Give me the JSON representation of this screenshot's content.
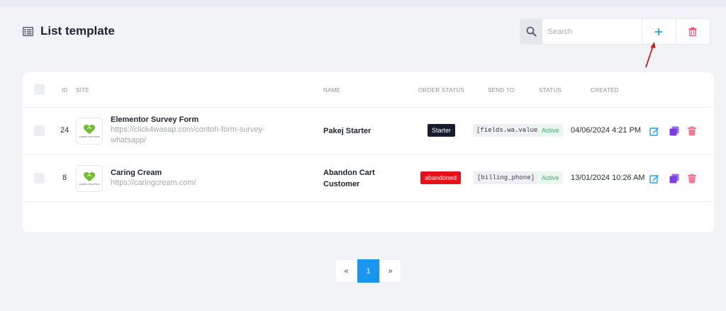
{
  "header": {
    "title": "List template",
    "search_placeholder": "Search",
    "icons": {
      "list": "list-icon",
      "search": "search-icon",
      "add": "plus-icon",
      "delete": "trash-icon"
    }
  },
  "table": {
    "columns": [
      "ID",
      "SITE",
      "NAME",
      "ORDER STATUS",
      "SEND TO",
      "STATUS",
      "CREATED"
    ],
    "rows": [
      {
        "id": "24",
        "site_name": "Elementor Survey Form",
        "site_url": "https://click4wasap.com/contoh-form-survey-whatsapp/",
        "logo_caption": "CARING SOLUTION",
        "name": "Pakej Starter",
        "order_status": "Starter",
        "send_to": "[fields.wa.value]",
        "status": "Active",
        "created": "04/06/2024 4:21 PM"
      },
      {
        "id": "8",
        "site_name": "Caring Cream",
        "site_url": "https://caringcream.com/",
        "logo_caption": "CARING SOLUTION",
        "name": "Abandon Cart Customer",
        "order_status": "abandoned",
        "send_to": "[billing_phone]",
        "status": "Active",
        "created": "13/01/2024 10:26 AM"
      }
    ]
  },
  "pagination": {
    "prev": "«",
    "current": "1",
    "next": "»"
  },
  "colors": {
    "accent": "#1a96f0",
    "badge_starter": "#161b2e",
    "badge_abandoned": "#e6111a",
    "status_active": "#34b26a",
    "edit": "#1aa3e8",
    "duplicate": "#7b3fe4",
    "delete": "#f37b95",
    "arrow": "#d11b1b"
  }
}
